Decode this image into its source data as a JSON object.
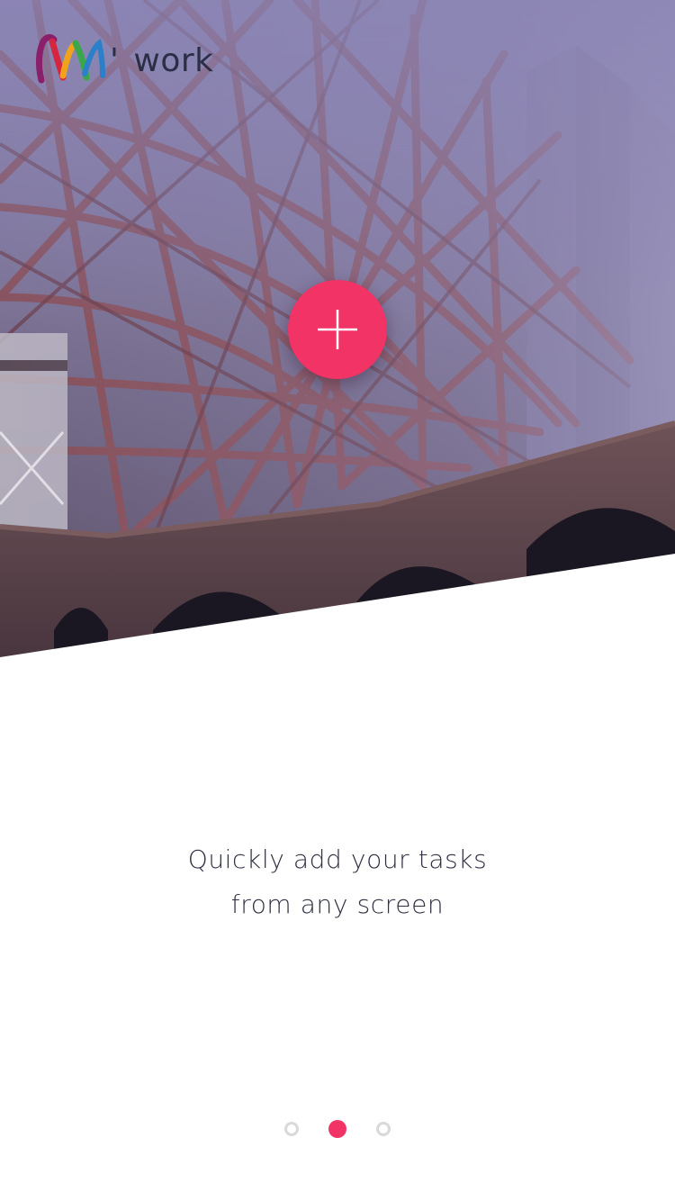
{
  "app": {
    "logo_word": "work",
    "logo_apostrophe": "'"
  },
  "hero": {
    "image": "bridge-steel-structure-photo"
  },
  "fab": {
    "icon": "plus-icon",
    "color": "#f23366"
  },
  "onboarding": {
    "line1": "Quickly add your tasks",
    "line2": "from any screen",
    "current_page": 2,
    "total_pages": 3
  },
  "colors": {
    "accent": "#f23366",
    "text": "#2e3042",
    "dot_inactive": "#d9d9d9"
  }
}
